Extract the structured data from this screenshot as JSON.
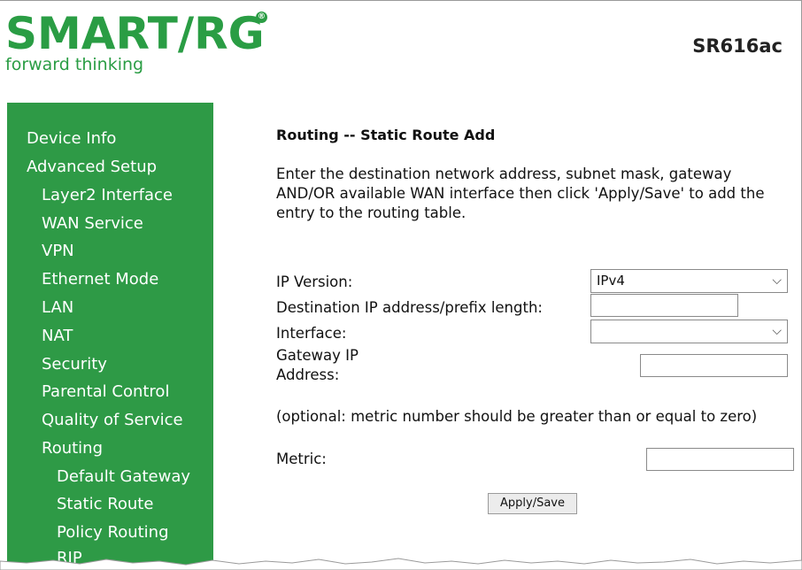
{
  "brand": {
    "logo": "SMART/RG",
    "registered_mark": "®",
    "tagline": "forward thinking",
    "model": "SR616ac"
  },
  "sidebar": {
    "items": [
      {
        "label": "Device Info"
      },
      {
        "label": "Advanced Setup"
      },
      {
        "label": "Layer2 Interface"
      },
      {
        "label": "WAN Service"
      },
      {
        "label": "VPN"
      },
      {
        "label": "Ethernet Mode"
      },
      {
        "label": "LAN"
      },
      {
        "label": "NAT"
      },
      {
        "label": "Security"
      },
      {
        "label": "Parental Control"
      },
      {
        "label": "Quality of Service"
      },
      {
        "label": "Routing"
      },
      {
        "label": "Default Gateway"
      },
      {
        "label": "Static Route"
      },
      {
        "label": "Policy Routing"
      },
      {
        "label": "RIP"
      }
    ]
  },
  "main": {
    "title": "Routing -- Static Route Add",
    "description": "Enter the destination network address, subnet mask, gateway AND/OR available WAN interface then click 'Apply/Save' to add the entry to the routing table.",
    "form": {
      "ip_version_label": "IP Version:",
      "ip_version_value": "IPv4",
      "destination_label": "Destination IP address/prefix length:",
      "destination_value": "",
      "interface_label": "Interface:",
      "interface_value": "",
      "gateway_label": "Gateway IP Address:",
      "gateway_value": "",
      "metric_note": "(optional: metric number should be greater than or equal to zero)",
      "metric_label": "Metric:",
      "metric_value": "",
      "apply_label": "Apply/Save"
    }
  },
  "colors": {
    "brand_green": "#2a9d44",
    "sidebar_green": "#2e9a46",
    "nav_text": "#ffffff"
  },
  "icons": {
    "dropdown": "chevron-down-icon"
  }
}
